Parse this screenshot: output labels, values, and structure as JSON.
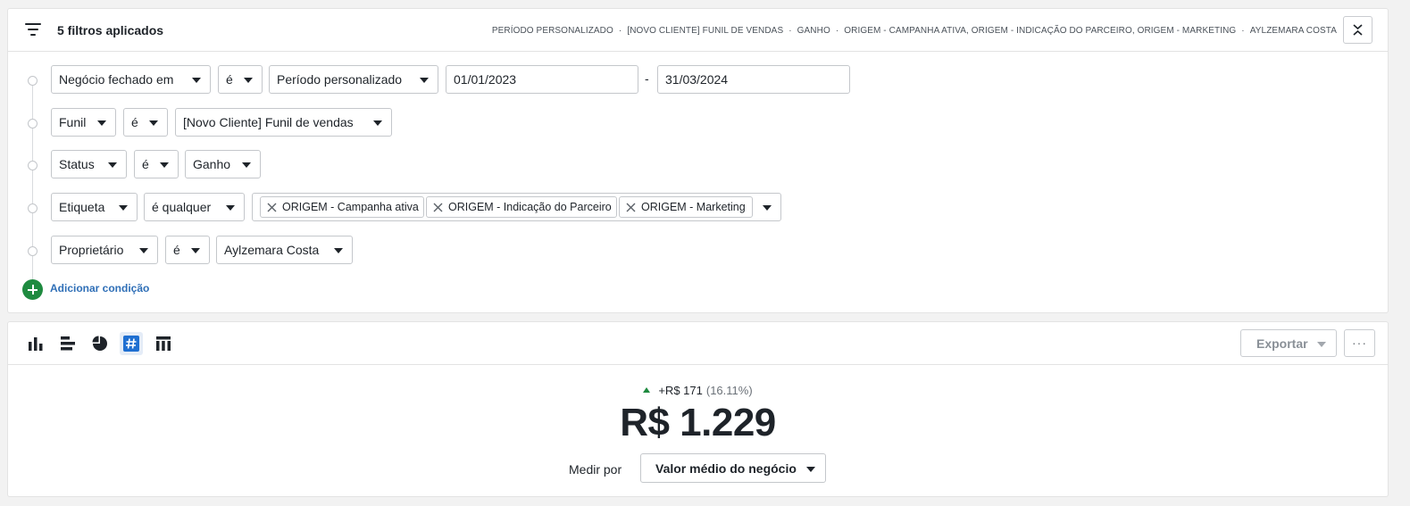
{
  "filters_header": {
    "title": "5 filtros aplicados",
    "summary": [
      "PERÍODO PERSONALIZADO",
      "[NOVO CLIENTE] FUNIL DE VENDAS",
      "GANHO",
      "ORIGEM - CAMPANHA ATIVA, ORIGEM - INDICAÇÃO DO PARCEIRO, ORIGEM - MARKETING",
      "AYLZEMARA COSTA"
    ],
    "summary_separator": "·"
  },
  "conditions": {
    "closed": {
      "field": "Negócio fechado em",
      "operator": "é",
      "period": "Período personalizado",
      "date_from": "01/01/2023",
      "date_separator": "-",
      "date_to": "31/03/2024"
    },
    "funnel": {
      "field": "Funil",
      "operator": "é",
      "value": "[Novo Cliente] Funil de vendas"
    },
    "status": {
      "field": "Status",
      "operator": "é",
      "value": "Ganho"
    },
    "tag": {
      "field": "Etiqueta",
      "operator": "é qualquer",
      "tags": [
        "ORIGEM - Campanha ativa",
        "ORIGEM - Indicação do Parceiro",
        "ORIGEM - Marketing"
      ]
    },
    "owner": {
      "field": "Proprietário",
      "operator": "é",
      "value": "Aylzemara Costa"
    }
  },
  "add_condition_label": "Adicionar condição",
  "toolbar": {
    "views": [
      "bar-chart-icon",
      "horizontal-bar-chart-icon",
      "pie-chart-icon",
      "number-icon",
      "table-icon"
    ],
    "active_view": "number-icon",
    "active_color": "#1f6fd1",
    "export_label": "Exportar",
    "more_label": "···"
  },
  "result": {
    "delta_value": "+R$ 171",
    "delta_percent": "(16.11%)",
    "delta_color": "#1e8a3f",
    "value": "R$ 1.229",
    "measure_label": "Medir por",
    "measure_value": "Valor médio do negócio"
  }
}
